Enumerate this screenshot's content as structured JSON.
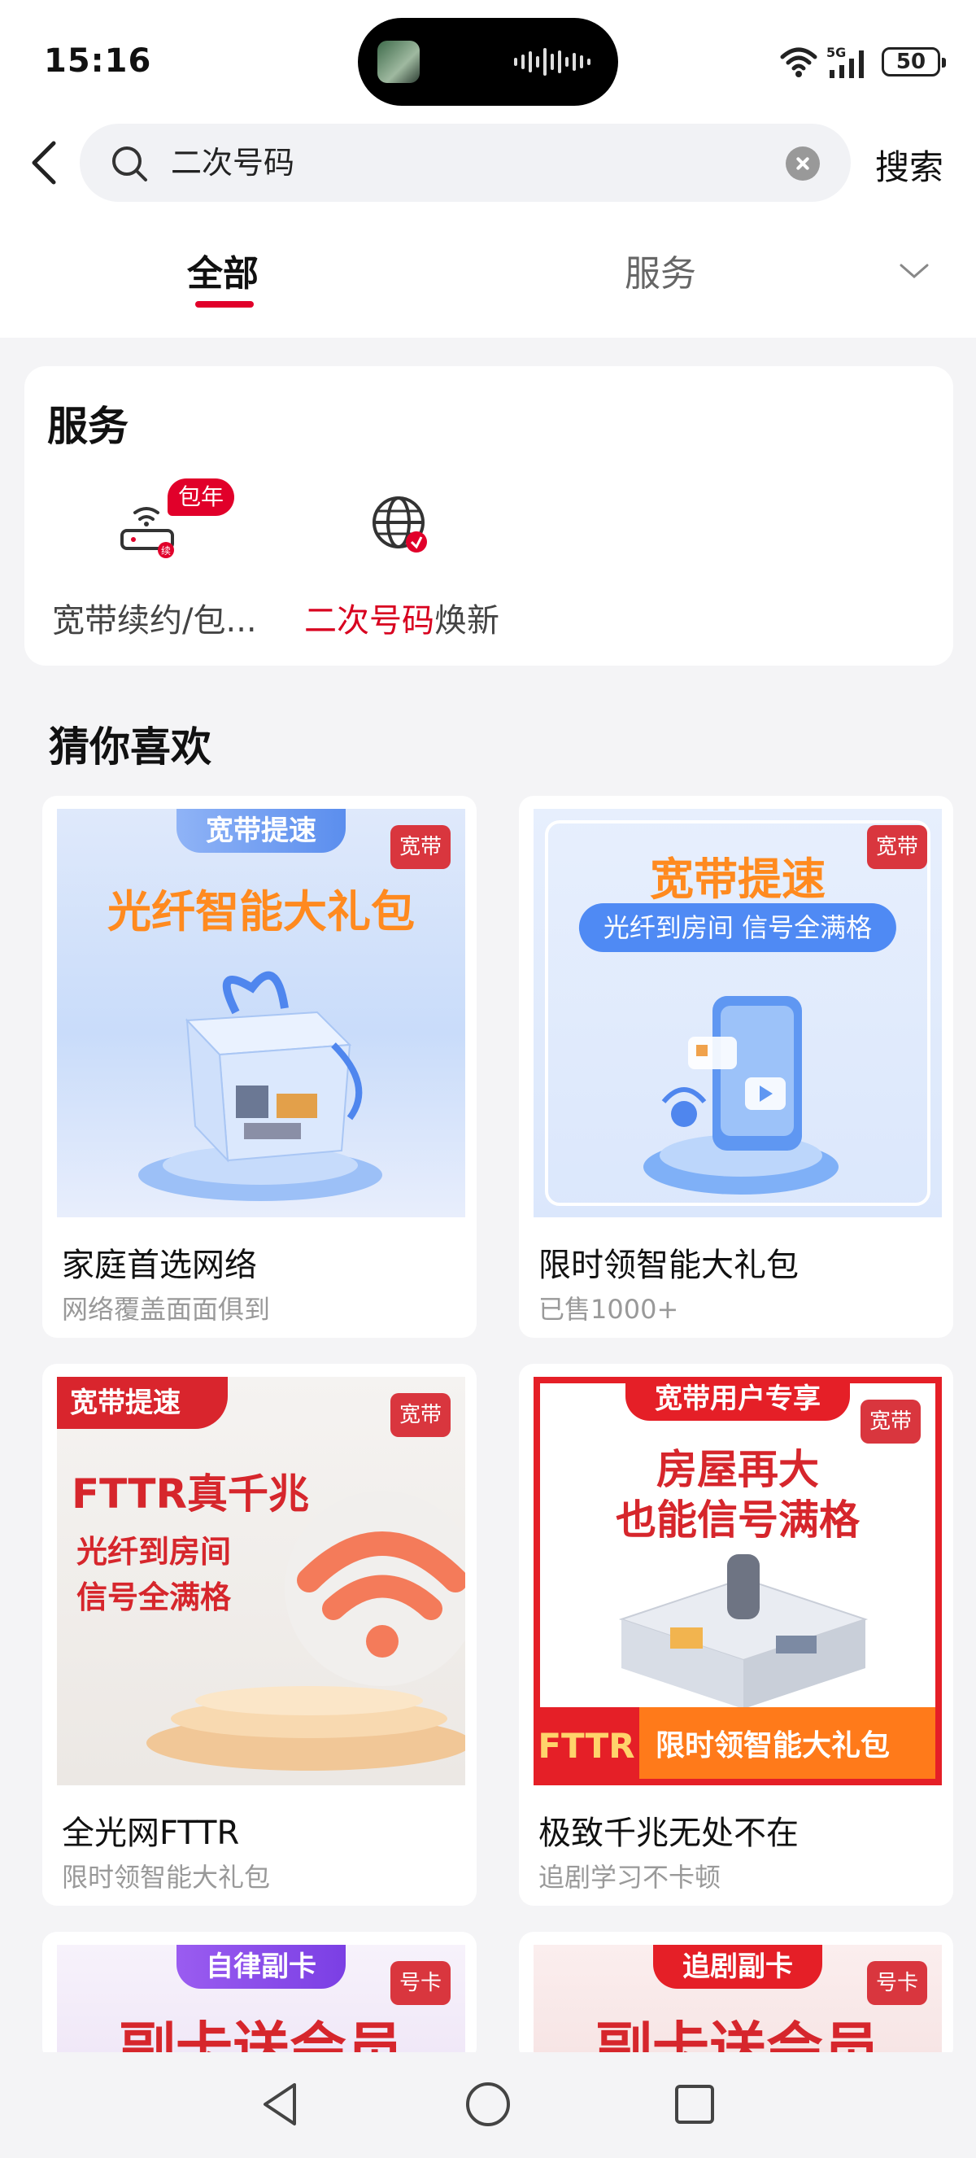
{
  "status_bar": {
    "time": "15:16",
    "battery": "50",
    "network": "5G"
  },
  "search": {
    "query": "二次号码",
    "button": "搜索"
  },
  "tabs": [
    {
      "label": "全部",
      "active": true
    },
    {
      "label": "服务",
      "active": false
    }
  ],
  "service_section": {
    "title": "服务",
    "items": [
      {
        "label": "宽带续约/包...",
        "badge": "包年",
        "icon": "router-icon"
      },
      {
        "label_highlight": "二次号码",
        "label_rest": "焕新",
        "icon": "globe-icon"
      }
    ]
  },
  "recommend": {
    "title": "猜你喜欢",
    "products": [
      {
        "title": "家庭首选网络",
        "subtitle": "网络覆盖面面俱到",
        "tag": "宽带",
        "banner": "宽带提速",
        "headline": "光纤智能大礼包"
      },
      {
        "title": "限时领智能大礼包",
        "subtitle": "已售1000+",
        "tag": "宽带",
        "headline": "宽带提速",
        "pill": "光纤到房间 信号全满格"
      },
      {
        "title": "全光网FTTR",
        "subtitle": "限时领智能大礼包",
        "tag": "宽带",
        "banner": "宽带提速",
        "headline": "FTTR真千兆",
        "line1": "光纤到房间",
        "line2": "信号全满格"
      },
      {
        "title": "极致千兆无处不在",
        "subtitle": "追剧学习不卡顿",
        "tag": "宽带",
        "banner": "宽带用户专享",
        "line1": "房屋再大",
        "line2": "也能信号满格",
        "fttr": "FTTR",
        "strip": "限时领智能大礼包"
      },
      {
        "tag": "号卡",
        "banner": "自律副卡",
        "headline": "副卡送会员"
      },
      {
        "tag": "号卡",
        "banner": "追剧副卡",
        "headline": "副卡送会员"
      }
    ]
  },
  "colors": {
    "accent": "#e1002a",
    "tag_bg": "#d9363e",
    "highlight": "#d8001f"
  }
}
